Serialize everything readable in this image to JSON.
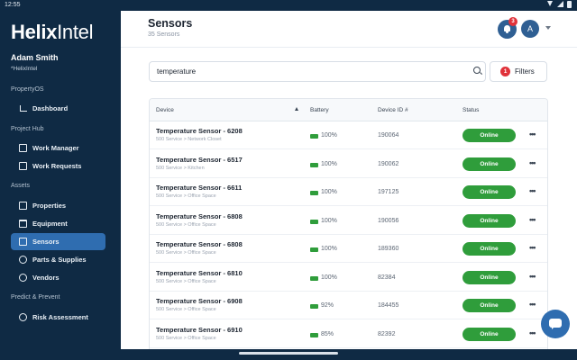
{
  "statusbar": {
    "time": "12:55"
  },
  "app": {
    "logo_bold": "Helix",
    "logo_light": "Intel"
  },
  "user": {
    "name": "Adam Smith",
    "org": "*HelixIntel"
  },
  "nav": {
    "sections": [
      "PropertyOS",
      "Project Hub",
      "Assets",
      "Predict & Prevent"
    ],
    "items": [
      {
        "label": "Dashboard",
        "icon": "chart-icon"
      },
      {
        "label": "Work Manager",
        "icon": "box-icon"
      },
      {
        "label": "Work Requests",
        "icon": "inbox-icon"
      },
      {
        "label": "Properties",
        "icon": "building-icon"
      },
      {
        "label": "Equipment",
        "icon": "calendar-icon"
      },
      {
        "label": "Sensors",
        "icon": "sensor-icon",
        "active": true
      },
      {
        "label": "Parts & Supplies",
        "icon": "tools-icon"
      },
      {
        "label": "Vendors",
        "icon": "vendor-icon"
      },
      {
        "label": "Risk Assessment",
        "icon": "globe-icon"
      }
    ]
  },
  "header": {
    "title": "Sensors",
    "subtitle": "35 Sensors",
    "notification_count": "3",
    "avatar_initial": "A"
  },
  "search": {
    "value": "temperature"
  },
  "filters": {
    "label": "Filters",
    "count": "1"
  },
  "table": {
    "columns": [
      "Device",
      "Battery",
      "Device ID #",
      "Status"
    ],
    "rows": [
      {
        "name": "Temperature Sensor - 6208",
        "location": "500 Service > Network Closet",
        "battery": "100%",
        "device_id": "190064",
        "status": "Online"
      },
      {
        "name": "Temperature Sensor - 6517",
        "location": "500 Service > Kitchen",
        "battery": "100%",
        "device_id": "190062",
        "status": "Online"
      },
      {
        "name": "Temperature Sensor - 6611",
        "location": "500 Service > Office Space",
        "battery": "100%",
        "device_id": "197125",
        "status": "Online"
      },
      {
        "name": "Temperature Sensor - 6808",
        "location": "500 Service > Office Space",
        "battery": "100%",
        "device_id": "190056",
        "status": "Online"
      },
      {
        "name": "Temperature Sensor - 6808",
        "location": "500 Service > Office Space",
        "battery": "100%",
        "device_id": "189360",
        "status": "Online"
      },
      {
        "name": "Temperature Sensor - 6810",
        "location": "500 Service > Office Space",
        "battery": "100%",
        "device_id": "82384",
        "status": "Online"
      },
      {
        "name": "Temperature Sensor - 6908",
        "location": "500 Service > Office Space",
        "battery": "92%",
        "device_id": "184455",
        "status": "Online"
      },
      {
        "name": "Temperature Sensor - 6910",
        "location": "500 Service > Office Space",
        "battery": "85%",
        "device_id": "82392",
        "status": "Online"
      }
    ]
  }
}
